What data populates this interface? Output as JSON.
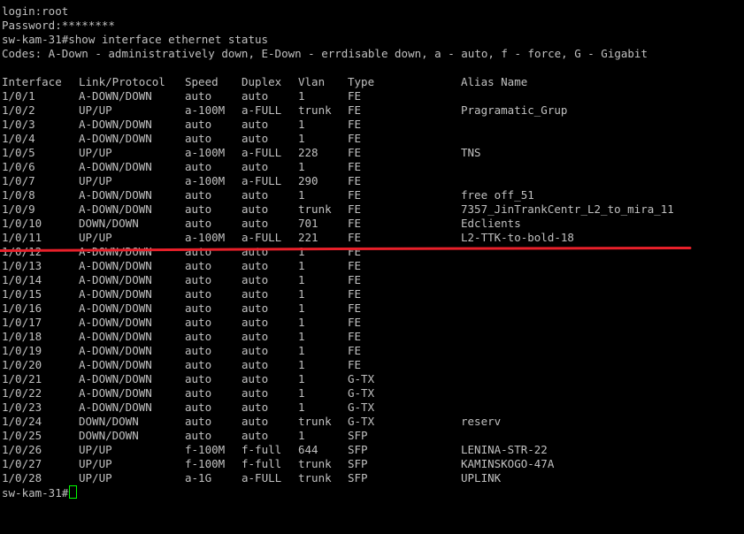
{
  "session": {
    "login_line": "login:root",
    "password_line": "Password:********",
    "command_line": "sw-kam-31#show interface ethernet status",
    "codes_line": "Codes: A-Down - administratively down, E-Down - errdisable down, a - auto, f - force, G - Gigabit",
    "prompt": "sw-kam-31#"
  },
  "table": {
    "headers": [
      "Interface",
      "Link/Protocol",
      "Speed",
      "Duplex",
      "Vlan",
      "Type",
      "Alias Name"
    ],
    "rows": [
      [
        "1/0/1",
        "A-DOWN/DOWN",
        "auto",
        "auto",
        "1",
        "FE",
        ""
      ],
      [
        "1/0/2",
        "UP/UP",
        "a-100M",
        "a-FULL",
        "trunk",
        "FE",
        "Pragramatic_Grup"
      ],
      [
        "1/0/3",
        "A-DOWN/DOWN",
        "auto",
        "auto",
        "1",
        "FE",
        ""
      ],
      [
        "1/0/4",
        "A-DOWN/DOWN",
        "auto",
        "auto",
        "1",
        "FE",
        ""
      ],
      [
        "1/0/5",
        "UP/UP",
        "a-100M",
        "a-FULL",
        "228",
        "FE",
        "TNS"
      ],
      [
        "1/0/6",
        "A-DOWN/DOWN",
        "auto",
        "auto",
        "1",
        "FE",
        ""
      ],
      [
        "1/0/7",
        "UP/UP",
        "a-100M",
        "a-FULL",
        "290",
        "FE",
        ""
      ],
      [
        "1/0/8",
        "A-DOWN/DOWN",
        "auto",
        "auto",
        "1",
        "FE",
        "free off_51"
      ],
      [
        "1/0/9",
        "A-DOWN/DOWN",
        "auto",
        "auto",
        "trunk",
        "FE",
        "7357_JinTrankCentr_L2_to_mira_11"
      ],
      [
        "1/0/10",
        "DOWN/DOWN",
        "auto",
        "auto",
        "701",
        "FE",
        "Edclients"
      ],
      [
        "1/0/11",
        "UP/UP",
        "a-100M",
        "a-FULL",
        "221",
        "FE",
        "L2-TTK-to-bold-18"
      ],
      [
        "1/0/12",
        "A-DOWN/DOWN",
        "auto",
        "auto",
        "1",
        "FE",
        ""
      ],
      [
        "1/0/13",
        "A-DOWN/DOWN",
        "auto",
        "auto",
        "1",
        "FE",
        ""
      ],
      [
        "1/0/14",
        "A-DOWN/DOWN",
        "auto",
        "auto",
        "1",
        "FE",
        ""
      ],
      [
        "1/0/15",
        "A-DOWN/DOWN",
        "auto",
        "auto",
        "1",
        "FE",
        ""
      ],
      [
        "1/0/16",
        "A-DOWN/DOWN",
        "auto",
        "auto",
        "1",
        "FE",
        ""
      ],
      [
        "1/0/17",
        "A-DOWN/DOWN",
        "auto",
        "auto",
        "1",
        "FE",
        ""
      ],
      [
        "1/0/18",
        "A-DOWN/DOWN",
        "auto",
        "auto",
        "1",
        "FE",
        ""
      ],
      [
        "1/0/19",
        "A-DOWN/DOWN",
        "auto",
        "auto",
        "1",
        "FE",
        ""
      ],
      [
        "1/0/20",
        "A-DOWN/DOWN",
        "auto",
        "auto",
        "1",
        "FE",
        ""
      ],
      [
        "1/0/21",
        "A-DOWN/DOWN",
        "auto",
        "auto",
        "1",
        "G-TX",
        ""
      ],
      [
        "1/0/22",
        "A-DOWN/DOWN",
        "auto",
        "auto",
        "1",
        "G-TX",
        ""
      ],
      [
        "1/0/23",
        "A-DOWN/DOWN",
        "auto",
        "auto",
        "1",
        "G-TX",
        ""
      ],
      [
        "1/0/24",
        "DOWN/DOWN",
        "auto",
        "auto",
        "trunk",
        "G-TX",
        "reserv"
      ],
      [
        "1/0/25",
        "DOWN/DOWN",
        "auto",
        "auto",
        "1",
        "SFP",
        ""
      ],
      [
        "1/0/26",
        "UP/UP",
        "f-100M",
        "f-full",
        "644",
        "SFP",
        "LENINA-STR-22"
      ],
      [
        "1/0/27",
        "UP/UP",
        "f-100M",
        "f-full",
        "trunk",
        "SFP",
        "KAMINSKOGO-47A"
      ],
      [
        "1/0/28",
        "UP/UP",
        "a-1G",
        "a-FULL",
        "trunk",
        "SFP",
        "UPLINK"
      ]
    ]
  },
  "colors": {
    "background": "#000000",
    "text": "#c0c0c0",
    "cursor": "#00ff00",
    "annotation": "#e8202a"
  }
}
